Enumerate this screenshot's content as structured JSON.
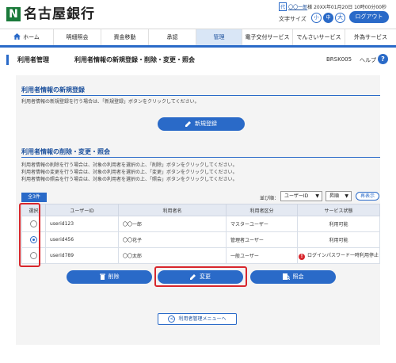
{
  "header": {
    "bank_name": "名古屋銀行",
    "logo_mark": "N",
    "user_prefix": "代",
    "user_name": "〇〇一郎",
    "user_suffix": "様",
    "last_login": "20XX年01月20日 10時00分00秒",
    "font_size_label": "文字サイズ",
    "font_small": "小",
    "font_mid": "中",
    "font_large": "大",
    "logout": "ログアウト"
  },
  "nav": {
    "items": [
      {
        "label": "ホーム",
        "icon": "home-icon"
      },
      {
        "label": "明細照会"
      },
      {
        "label": "資金移動"
      },
      {
        "label": "承認"
      },
      {
        "label": "管理"
      },
      {
        "label": "電子交付サービス"
      },
      {
        "label": "でんさいサービス"
      },
      {
        "label": "外為サービス"
      }
    ],
    "active_index": 4
  },
  "title": {
    "main": "利用者管理",
    "sub": "利用者情報の新規登録・削除・変更・照会",
    "screen_id": "BRSK005",
    "help": "ヘルプ",
    "help_icon": "?"
  },
  "new_section": {
    "title": "利用者情報の新規登録",
    "desc": "利用者情報の新規登録を行う場合は、「新規登録」ボタンをクリックしてください。",
    "button": "新規登録"
  },
  "edit_section": {
    "title": "利用者情報の削除・変更・照会",
    "desc1": "利用者情報の削除を行う場合は、対象の利用者を選択の上、「削除」ボタンをクリックしてください。",
    "desc2": "利用者情報の変更を行う場合は、対象の利用者を選択の上、「変更」ボタンをクリックしてください。",
    "desc3": "利用者情報の照会を行う場合は、対象の利用者を選択の上、「照会」ボタンをクリックしてください。"
  },
  "list": {
    "count": "全3件",
    "sort_label": "並び順：",
    "sort_field": "ユーザーID",
    "sort_order": "昇順",
    "redisplay": "再表示",
    "columns": [
      "選択",
      "ユーザーID",
      "利用者名",
      "利用者区分",
      "サービス状態"
    ],
    "rows": [
      {
        "selected": false,
        "user_id": "userid123",
        "name": "〇〇一郎",
        "type": "マスターユーザー",
        "status": "利用可能",
        "warning": false
      },
      {
        "selected": true,
        "user_id": "userid456",
        "name": "〇〇花子",
        "type": "管理者ユーザー",
        "status": "利用可能",
        "warning": false
      },
      {
        "selected": false,
        "user_id": "userid789",
        "name": "〇〇太郎",
        "type": "一般ユーザー",
        "status": "ログインパスワード一時利用停止",
        "warning": true
      }
    ]
  },
  "actions": {
    "delete": "削除",
    "change": "変更",
    "inquiry": "照会"
  },
  "back_button": "利用者管理メニューへ",
  "colors": {
    "primary": "#2a6ac8",
    "brand_green": "#1a7a3a",
    "highlight_red": "#d8262c"
  }
}
